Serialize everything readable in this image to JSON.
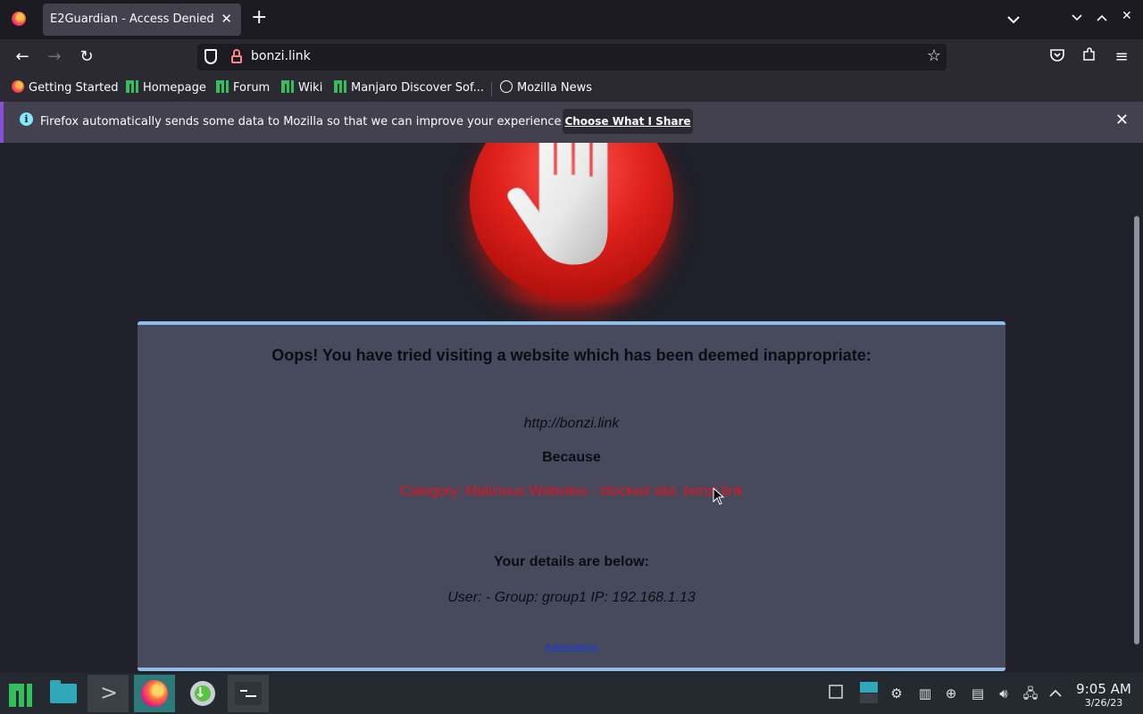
{
  "browser": {
    "tab": {
      "title": "E2Guardian - Access Denied",
      "close": "✕"
    },
    "new_tab": "+",
    "window_controls": {
      "list_tabs": "⌄",
      "minimize": "⌄",
      "maximize": "⌃",
      "close": "✕"
    },
    "nav": {
      "back": "←",
      "forward": "→",
      "reload": "↻"
    },
    "url": "bonzi.link",
    "toolbar_icons": {
      "pocket": "pocket-icon",
      "extensions": "extensions-icon",
      "menu": "≡"
    }
  },
  "bookmarks": [
    {
      "label": "Getting Started",
      "icon": "firefox-icon"
    },
    {
      "label": "Homepage",
      "icon": "manjaro-icon"
    },
    {
      "label": "Forum",
      "icon": "manjaro-icon"
    },
    {
      "label": "Wiki",
      "icon": "manjaro-icon"
    },
    {
      "label": "Manjaro Discover Sof...",
      "icon": "manjaro-icon"
    },
    {
      "label": "Mozilla News",
      "icon": "globe-icon"
    }
  ],
  "notification": {
    "text": "Firefox automatically sends some data to Mozilla so that we can improve your experience.",
    "button": "Choose What I Share",
    "close": "✕"
  },
  "page": {
    "heading": "Oops! You have tried visiting a website which has been deemed inappropriate:",
    "blocked_url": "http://bonzi.link",
    "because_label": "Because",
    "reason": "Category: Malicious Websites - blocked site: bonzi.link",
    "details_heading": "Your details are below:",
    "details": "User: -   Group: group1   IP: 192.168.1.13",
    "acknowledge": "Acknowledge"
  },
  "taskbar": {
    "apps": [
      "manjaro-menu",
      "file-manager",
      "terminal",
      "firefox",
      "downloader",
      "terminal-dark"
    ],
    "clock": {
      "time": "9:05 AM",
      "date": "3/26/23"
    }
  },
  "colors": {
    "accent": "#8fbde8",
    "reason_red": "#e8101c",
    "card_bg": "#474a5c"
  }
}
